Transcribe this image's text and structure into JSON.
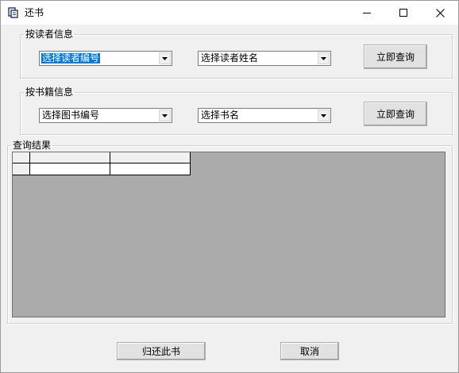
{
  "window": {
    "title": "还书",
    "app_icon": "book-app-icon",
    "controls": {
      "minimize": "minimize-icon",
      "maximize": "maximize-icon",
      "close": "close-icon"
    }
  },
  "reader_group": {
    "legend": "按读者信息",
    "id_combo": {
      "value": "选择读者编号",
      "selected": true
    },
    "name_combo": {
      "value": "选择读者姓名"
    },
    "query_button": "立即查询"
  },
  "book_group": {
    "legend": "按书籍信息",
    "id_combo": {
      "value": "选择图书编号"
    },
    "name_combo": {
      "value": "选择书名"
    },
    "query_button": "立即查询"
  },
  "results_group": {
    "legend": "查询结果",
    "grid": {
      "header": [
        "",
        "",
        ""
      ],
      "rows": [
        [
          "",
          "",
          ""
        ]
      ]
    }
  },
  "footer": {
    "return_button": "归还此书",
    "cancel_button": "取消"
  },
  "colors": {
    "selection": "#0078d7",
    "window_bg": "#f0f0f0",
    "grid_bg": "#ababab"
  }
}
